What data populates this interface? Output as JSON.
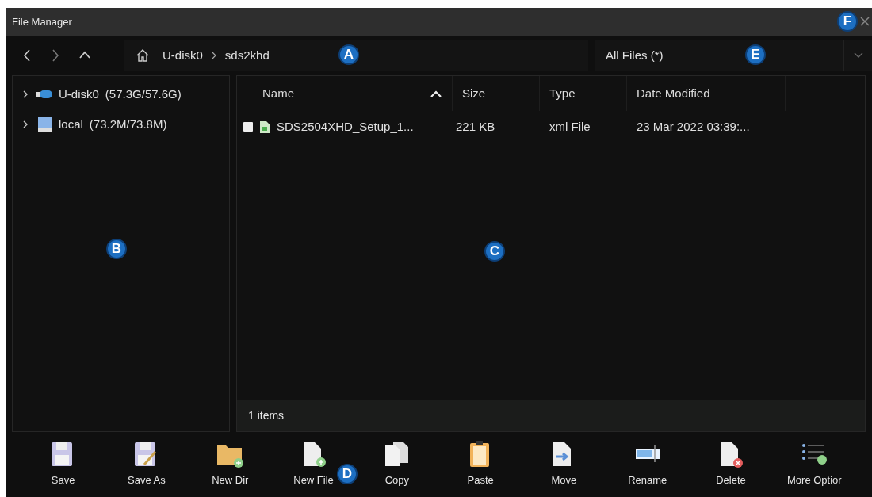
{
  "window": {
    "title": "File Manager",
    "callout": "F"
  },
  "address_bar": {
    "path": [
      {
        "kind": "home"
      },
      {
        "kind": "crumb",
        "label": "U-disk0"
      },
      {
        "kind": "crumb",
        "label": "sds2khd"
      }
    ],
    "callout": "A"
  },
  "filter": {
    "value": "All Files (*)",
    "callout": "E"
  },
  "sidebar": {
    "callout": "B",
    "items": [
      {
        "kind": "usb",
        "label": "U-disk0",
        "detail": "(57.3G/57.6G)",
        "expanded": false
      },
      {
        "kind": "disk",
        "label": "local",
        "detail": "(73.2M/73.8M)",
        "expanded": false
      }
    ]
  },
  "file_list": {
    "callout": "C",
    "columns": [
      {
        "label": "Name",
        "sorted": true
      },
      {
        "label": "Size",
        "sorted": false
      },
      {
        "label": "Type",
        "sorted": false
      },
      {
        "label": "Date Modified",
        "sorted": false
      }
    ],
    "rows": [
      {
        "checked": false,
        "name": "SDS2504XHD_Setup_1...",
        "size": "221 KB",
        "type": "xml File",
        "modified": "23 Mar 2022 03:39:..."
      }
    ],
    "status": "1 items"
  },
  "toolbar": {
    "callout": "D",
    "buttons": [
      {
        "kind": "save",
        "label": "Save"
      },
      {
        "kind": "save_as",
        "label": "Save As"
      },
      {
        "kind": "new_dir",
        "label": "New Dir"
      },
      {
        "kind": "new_file",
        "label": "New File"
      },
      {
        "kind": "copy",
        "label": "Copy"
      },
      {
        "kind": "paste",
        "label": "Paste"
      },
      {
        "kind": "move",
        "label": "Move"
      },
      {
        "kind": "rename",
        "label": "Rename"
      },
      {
        "kind": "delete",
        "label": "Delete"
      },
      {
        "kind": "more",
        "label": "More Optior"
      }
    ]
  }
}
